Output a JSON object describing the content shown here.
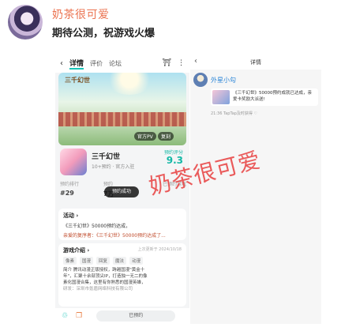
{
  "post": {
    "username": "奶茶很可爱",
    "text": "期待公测，祝游戏火爆"
  },
  "left_screenshot": {
    "nav": {
      "back": "‹",
      "tab_active": "详情",
      "tab_reviews": "评价",
      "tab_forum": "论坛",
      "icon_gift": "⛩",
      "icon_more": "⋮"
    },
    "banner": {
      "logo": "三千幻世",
      "pill_left": "官方PV",
      "pill_right": "复刻"
    },
    "game": {
      "name": "三千幻世",
      "meta": "10+预约 · 官方入驻",
      "score_label": "预约评分",
      "score": "9.3"
    },
    "stats": [
      {
        "label": "预约排行",
        "value": "#29"
      },
      {
        "label": "预约",
        "value": "7万"
      },
      {
        "label": "",
        "value": ""
      },
      {
        "label": "已预约游戏 ",
        "value": ""
      }
    ],
    "toast": "预约成功",
    "activity": {
      "title": "活动 ›",
      "line1": "《三千幻世》50000预约达成，",
      "line2": "亲爱的复序者：《三千幻世》50000预约达成了..."
    },
    "intro": {
      "title": "游戏介绍 ›",
      "updated": "上次更新于 2024/10/18",
      "tags": [
        "像素",
        "国漫",
        "回复",
        "魔法",
        "动漫"
      ],
      "line1": "简介 腾讯动漫正版授权，跨越国漫\"黄金十",
      "line2": "年\"，汇聚十余部顶尖IP，打造独一无二的像",
      "line3": "素化国漫合集，这里有你熟悉的国漫英雄，",
      "line4": "研发：深圳市氪盾网络科技有限公司"
    },
    "bottom": {
      "reserve_label": "已预约"
    }
  },
  "right_screenshot": {
    "nav": {
      "back": "‹",
      "title": "详情"
    },
    "user": {
      "name": "外星小勾"
    },
    "message": {
      "line1": "《三千幻世》50000预约成就已达成，亲",
      "line2": "爱卡奖励大派送!"
    },
    "meta": "21:36  TapTap及时获得 ♡"
  },
  "watermark": "奶茶很可爱"
}
